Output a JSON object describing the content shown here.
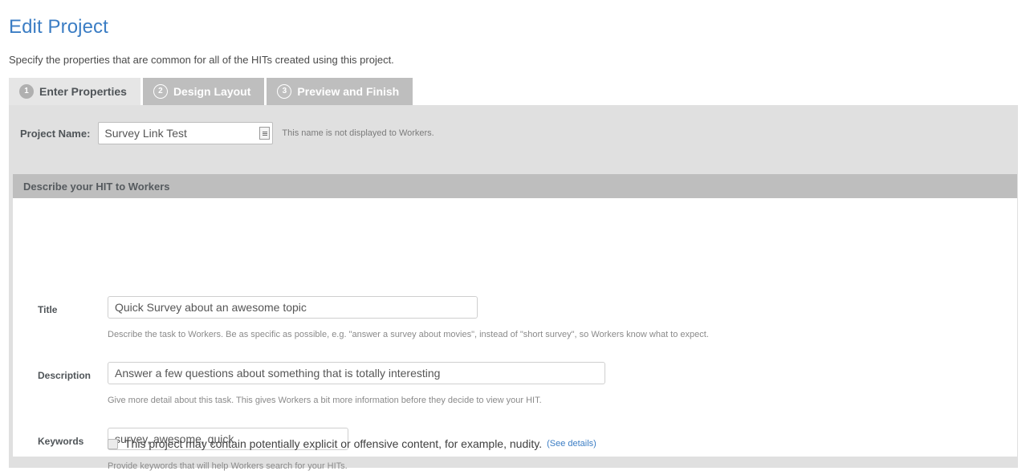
{
  "page": {
    "title": "Edit Project",
    "subtitle": "Specify the properties that are common for all of the HITs created using this project.",
    "accent_color": "#3b7dc4"
  },
  "tabs": [
    {
      "number": "1",
      "label": "Enter Properties",
      "state": "active"
    },
    {
      "number": "2",
      "label": "Design Layout",
      "state": "inactive"
    },
    {
      "number": "3",
      "label": "Preview and Finish",
      "state": "inactive"
    }
  ],
  "project_name": {
    "label": "Project Name:",
    "value": "Survey Link Test",
    "placeholder": "",
    "note": "This name is not displayed to Workers."
  },
  "section": {
    "header": "Describe your HIT to Workers",
    "fields": [
      {
        "label": "Title",
        "value": "Quick Survey about an awesome topic",
        "placeholder": "",
        "help": "Describe the task to Workers. Be as specific as possible, e.g. \"answer a survey about movies\", instead of \"short survey\", so Workers know what to expect."
      },
      {
        "label": "Description",
        "value": "Answer a few questions about something that is totally interesting",
        "placeholder": "",
        "help": "Give more detail about this task. This gives Workers a bit more information before they decide to view your HIT."
      },
      {
        "label": "Keywords",
        "value": "survey, awesome, quick",
        "placeholder": "",
        "help": "Provide keywords that will help Workers search for your HITs."
      }
    ],
    "adult_content": {
      "checked": false,
      "label": "This project may contain potentially explicit or offensive content, for example, nudity.",
      "link": "(See details)"
    }
  }
}
